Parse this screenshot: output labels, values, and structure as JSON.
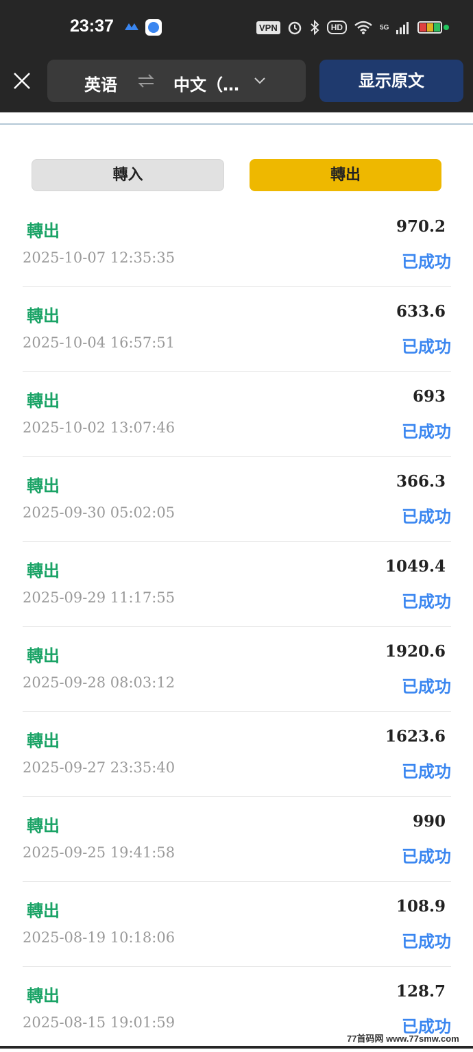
{
  "status_bar": {
    "time": "23:37",
    "vpn": "VPN",
    "hd": "HD",
    "network": "5G",
    "icons": [
      "cloud-app-icon",
      "app-badge-icon",
      "alarm-icon",
      "bluetooth-icon",
      "wifi-icon",
      "signal-icon",
      "battery-icon"
    ]
  },
  "translate_bar": {
    "source_lang": "英语",
    "target_lang": "中文（…",
    "show_original": "显示原文"
  },
  "tabs": {
    "in_label": "轉入",
    "out_label": "轉出",
    "active": "out",
    "active_color": "#eeb800"
  },
  "transactions": [
    {
      "type": "轉出",
      "time": "2025-10-07 12:35:35",
      "amount": "970.2",
      "status": "已成功"
    },
    {
      "type": "轉出",
      "time": "2025-10-04 16:57:51",
      "amount": "633.6",
      "status": "已成功"
    },
    {
      "type": "轉出",
      "time": "2025-10-02 13:07:46",
      "amount": "693",
      "status": "已成功"
    },
    {
      "type": "轉出",
      "time": "2025-09-30 05:02:05",
      "amount": "366.3",
      "status": "已成功"
    },
    {
      "type": "轉出",
      "time": "2025-09-29 11:17:55",
      "amount": "1049.4",
      "status": "已成功"
    },
    {
      "type": "轉出",
      "time": "2025-09-28 08:03:12",
      "amount": "1920.6",
      "status": "已成功"
    },
    {
      "type": "轉出",
      "time": "2025-09-27 23:35:40",
      "amount": "1623.6",
      "status": "已成功"
    },
    {
      "type": "轉出",
      "time": "2025-09-25 19:41:58",
      "amount": "990",
      "status": "已成功"
    },
    {
      "type": "轉出",
      "time": "2025-08-19 10:18:06",
      "amount": "108.9",
      "status": "已成功"
    },
    {
      "type": "轉出",
      "time": "2025-08-15 19:01:59",
      "amount": "128.7",
      "status": "已成功"
    }
  ],
  "colors": {
    "type_text": "#1aa366",
    "status_text": "#3a86f0",
    "header_bg": "#262626",
    "show_original_bg": "#1f3a6e"
  },
  "watermark": "77首码网 www.77smw.com"
}
